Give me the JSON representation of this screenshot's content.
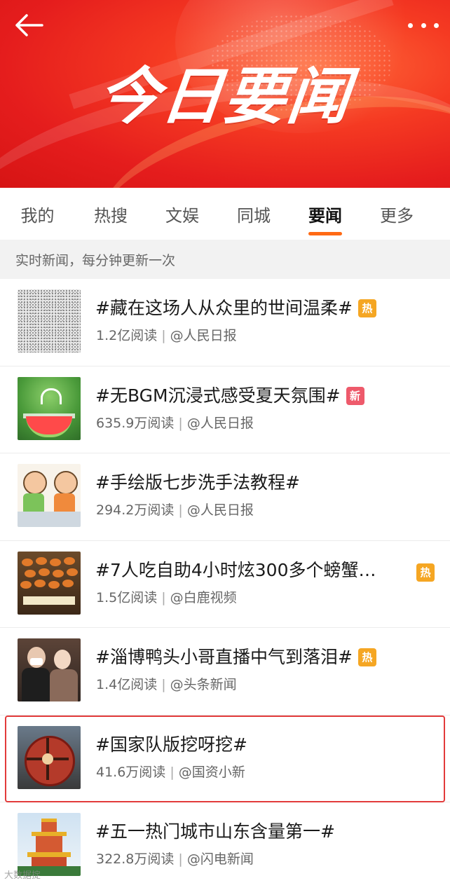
{
  "banner": {
    "title": "今日要闻",
    "back_icon": "back-arrow-icon",
    "more_icon": "more-dots-icon"
  },
  "tabs": [
    {
      "label": "我的",
      "active": false
    },
    {
      "label": "热搜",
      "active": false
    },
    {
      "label": "文娱",
      "active": false
    },
    {
      "label": "同城",
      "active": false
    },
    {
      "label": "要闻",
      "active": true
    },
    {
      "label": "更多",
      "active": false
    }
  ],
  "subheader": "实时新闻，每分钟更新一次",
  "colors": {
    "banner_red": "#e51d1d",
    "tab_indicator": "#ff6a14",
    "hot_badge": "#f5a623",
    "new_badge": "#ee5a6b",
    "highlight_border": "#e23b3b"
  },
  "items": [
    {
      "title": "#藏在这场人从众里的世间温柔#",
      "reads": "1.2亿阅读",
      "source": "@人民日报",
      "badge": "热"
    },
    {
      "title": "#无BGM沉浸式感受夏天氛围#",
      "reads": "635.9万阅读",
      "source": "@人民日报",
      "badge": "新"
    },
    {
      "title": "#手绘版七步洗手法教程#",
      "reads": "294.2万阅读",
      "source": "@人民日报",
      "badge": ""
    },
    {
      "title": "#7人吃自助4小时炫300多个螃蟹…",
      "reads": "1.5亿阅读",
      "source": "@白鹿视频",
      "badge": "热"
    },
    {
      "title": "#淄博鸭头小哥直播中气到落泪#",
      "reads": "1.4亿阅读",
      "source": "@头条新闻",
      "badge": "热"
    },
    {
      "title": "#国家队版挖呀挖#",
      "reads": "41.6万阅读",
      "source": "@国资小新",
      "badge": ""
    },
    {
      "title": "#五一热门城市山东含量第一#",
      "reads": "322.8万阅读",
      "source": "@闪电新闻",
      "badge": ""
    }
  ],
  "separator": "|",
  "watermark": "大数据掟"
}
